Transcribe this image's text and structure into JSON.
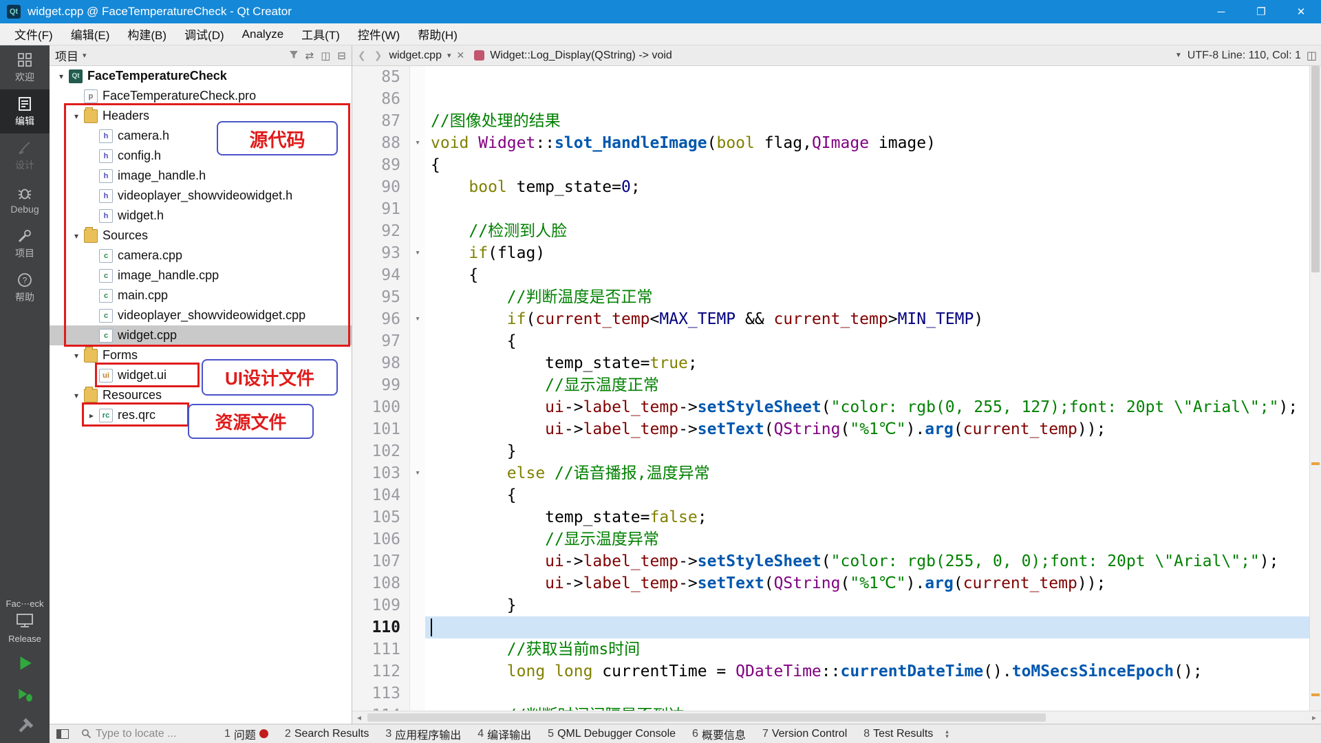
{
  "window": {
    "title": "widget.cpp @ FaceTemperatureCheck - Qt Creator",
    "controls": [
      {
        "id": "minimize",
        "glyph": "─"
      },
      {
        "id": "maximize",
        "glyph": "❐"
      },
      {
        "id": "close",
        "glyph": "✕"
      }
    ],
    "app_icon_text": "Qt"
  },
  "menu": {
    "items": [
      {
        "id": "file",
        "label": "文件(F)"
      },
      {
        "id": "edit",
        "label": "编辑(E)"
      },
      {
        "id": "build",
        "label": "构建(B)"
      },
      {
        "id": "debug",
        "label": "调试(D)"
      },
      {
        "id": "analyze",
        "label": "Analyze"
      },
      {
        "id": "tools",
        "label": "工具(T)"
      },
      {
        "id": "window",
        "label": "控件(W)"
      },
      {
        "id": "help",
        "label": "帮助(H)"
      }
    ]
  },
  "sidebar": {
    "modes": [
      {
        "id": "welcome",
        "label": "欢迎",
        "icon": "welcome-icon"
      },
      {
        "id": "edit",
        "label": "编辑",
        "icon": "edit-icon",
        "active": true
      },
      {
        "id": "design",
        "label": "设计",
        "icon": "design-icon",
        "disabled": true
      },
      {
        "id": "debug",
        "label": "Debug",
        "icon": "debug-icon"
      },
      {
        "id": "projects",
        "label": "项目",
        "icon": "projects-icon"
      },
      {
        "id": "help",
        "label": "帮助",
        "icon": "help-icon"
      }
    ],
    "kit": {
      "name": "Fac⋯eck",
      "build": "Release"
    }
  },
  "project": {
    "title": "项目",
    "header_icons": [
      {
        "id": "filter-icon",
        "glyph": "▼"
      },
      {
        "id": "sync-with-editor-icon",
        "glyph": "⇄"
      },
      {
        "id": "split-icon",
        "glyph": "◫"
      },
      {
        "id": "collapse-icon",
        "glyph": "⊟"
      }
    ],
    "tree": [
      {
        "label": "FaceTemperatureCheck",
        "depth": 0,
        "icon": "project",
        "chev": "d",
        "bold": true
      },
      {
        "label": "FaceTemperatureCheck.pro",
        "depth": 1,
        "icon": "pro"
      },
      {
        "label": "Headers",
        "depth": 1,
        "icon": "folder",
        "chev": "d"
      },
      {
        "label": "camera.h",
        "depth": 2,
        "icon": "h"
      },
      {
        "label": "config.h",
        "depth": 2,
        "icon": "h"
      },
      {
        "label": "image_handle.h",
        "depth": 2,
        "icon": "h"
      },
      {
        "label": "videoplayer_showvideowidget.h",
        "depth": 2,
        "icon": "h"
      },
      {
        "label": "widget.h",
        "depth": 2,
        "icon": "h"
      },
      {
        "label": "Sources",
        "depth": 1,
        "icon": "folder",
        "chev": "d"
      },
      {
        "label": "camera.cpp",
        "depth": 2,
        "icon": "cpp"
      },
      {
        "label": "image_handle.cpp",
        "depth": 2,
        "icon": "cpp"
      },
      {
        "label": "main.cpp",
        "depth": 2,
        "icon": "cpp"
      },
      {
        "label": "videoplayer_showvideowidget.cpp",
        "depth": 2,
        "icon": "cpp"
      },
      {
        "label": "widget.cpp",
        "depth": 2,
        "icon": "cpp",
        "selected": true
      },
      {
        "label": "Forms",
        "depth": 1,
        "icon": "folder",
        "chev": "d"
      },
      {
        "label": "widget.ui",
        "depth": 2,
        "icon": "ui"
      },
      {
        "label": "Resources",
        "depth": 1,
        "icon": "folder",
        "chev": "d"
      },
      {
        "label": "res.qrc",
        "depth": 2,
        "icon": "qrc",
        "chev": "r"
      }
    ]
  },
  "annotations": {
    "source_label": "源代码",
    "ui_label": "UI设计文件",
    "res_label": "资源文件"
  },
  "editor": {
    "toolbar": {
      "back": "❮",
      "forward": "❯",
      "tab": "widget.cpp",
      "tab_caret": "▾",
      "close": "✕",
      "symbol": "Widget::Log_Display(QString) -> void",
      "enc_caret": "▼",
      "encoding": "UTF-8 Line: 110, Col: 1",
      "split": "◫"
    },
    "lines": [
      {
        "n": 85,
        "tk": []
      },
      {
        "n": 86,
        "tk": []
      },
      {
        "n": 87,
        "tk": [
          [
            "c",
            "//图像处理的结果"
          ]
        ]
      },
      {
        "n": 88,
        "f": 1,
        "tk": [
          [
            "k",
            "void"
          ],
          [
            "d",
            " "
          ],
          [
            "t",
            "Widget"
          ],
          [
            "d",
            "::"
          ],
          [
            "fn",
            "slot_HandleImage"
          ],
          [
            "d",
            "("
          ],
          [
            "k",
            "bool"
          ],
          [
            "d",
            " flag,"
          ],
          [
            "t",
            "QImage"
          ],
          [
            "d",
            " image)"
          ]
        ]
      },
      {
        "n": 89,
        "tk": [
          [
            "d",
            "{"
          ]
        ]
      },
      {
        "n": 90,
        "tk": [
          [
            "d",
            "    "
          ],
          [
            "k",
            "bool"
          ],
          [
            "d",
            " temp_state="
          ],
          [
            "num",
            "0"
          ],
          [
            "d",
            ";"
          ]
        ]
      },
      {
        "n": 91,
        "tk": []
      },
      {
        "n": 92,
        "tk": [
          [
            "d",
            "    "
          ],
          [
            "c",
            "//检测到人脸"
          ]
        ]
      },
      {
        "n": 93,
        "f": 1,
        "tk": [
          [
            "d",
            "    "
          ],
          [
            "k",
            "if"
          ],
          [
            "d",
            "(flag)"
          ]
        ]
      },
      {
        "n": 94,
        "tk": [
          [
            "d",
            "    {"
          ]
        ]
      },
      {
        "n": 95,
        "tk": [
          [
            "d",
            "        "
          ],
          [
            "c",
            "//判断温度是否正常"
          ]
        ]
      },
      {
        "n": 96,
        "f": 1,
        "tk": [
          [
            "d",
            "        "
          ],
          [
            "k",
            "if"
          ],
          [
            "d",
            "("
          ],
          [
            "v",
            "current_temp"
          ],
          [
            "d",
            "<"
          ],
          [
            "m",
            "MAX_TEMP"
          ],
          [
            "d",
            " && "
          ],
          [
            "v",
            "current_temp"
          ],
          [
            "d",
            ">"
          ],
          [
            "m",
            "MIN_TEMP"
          ],
          [
            "d",
            ")"
          ]
        ]
      },
      {
        "n": 97,
        "tk": [
          [
            "d",
            "        {"
          ]
        ]
      },
      {
        "n": 98,
        "tk": [
          [
            "d",
            "            temp_state="
          ],
          [
            "k",
            "true"
          ],
          [
            "d",
            ";"
          ]
        ]
      },
      {
        "n": 99,
        "tk": [
          [
            "d",
            "            "
          ],
          [
            "c",
            "//显示温度正常"
          ]
        ]
      },
      {
        "n": 100,
        "tk": [
          [
            "d",
            "            "
          ],
          [
            "v",
            "ui"
          ],
          [
            "d",
            "->"
          ],
          [
            "v",
            "label_temp"
          ],
          [
            "d",
            "->"
          ],
          [
            "fn",
            "setStyleSheet"
          ],
          [
            "d",
            "("
          ],
          [
            "s",
            "\"color: rgb(0, 255, 127);font: 20pt \\\"Arial\\\";\""
          ],
          [
            "d",
            ");"
          ]
        ]
      },
      {
        "n": 101,
        "tk": [
          [
            "d",
            "            "
          ],
          [
            "v",
            "ui"
          ],
          [
            "d",
            "->"
          ],
          [
            "v",
            "label_temp"
          ],
          [
            "d",
            "->"
          ],
          [
            "fn",
            "setText"
          ],
          [
            "d",
            "("
          ],
          [
            "t",
            "QString"
          ],
          [
            "d",
            "("
          ],
          [
            "s",
            "\"%1℃\""
          ],
          [
            "d",
            ")."
          ],
          [
            "fn",
            "arg"
          ],
          [
            "d",
            "("
          ],
          [
            "v",
            "current_temp"
          ],
          [
            "d",
            "));"
          ]
        ]
      },
      {
        "n": 102,
        "tk": [
          [
            "d",
            "        }"
          ]
        ]
      },
      {
        "n": 103,
        "f": 1,
        "tk": [
          [
            "d",
            "        "
          ],
          [
            "k",
            "else"
          ],
          [
            "d",
            " "
          ],
          [
            "c",
            "//语音播报,温度异常"
          ]
        ]
      },
      {
        "n": 104,
        "tk": [
          [
            "d",
            "        {"
          ]
        ]
      },
      {
        "n": 105,
        "tk": [
          [
            "d",
            "            temp_state="
          ],
          [
            "k",
            "false"
          ],
          [
            "d",
            ";"
          ]
        ]
      },
      {
        "n": 106,
        "tk": [
          [
            "d",
            "            "
          ],
          [
            "c",
            "//显示温度异常"
          ]
        ]
      },
      {
        "n": 107,
        "tk": [
          [
            "d",
            "            "
          ],
          [
            "v",
            "ui"
          ],
          [
            "d",
            "->"
          ],
          [
            "v",
            "label_temp"
          ],
          [
            "d",
            "->"
          ],
          [
            "fn",
            "setStyleSheet"
          ],
          [
            "d",
            "("
          ],
          [
            "s",
            "\"color: rgb(255, 0, 0);font: 20pt \\\"Arial\\\";\""
          ],
          [
            "d",
            ");"
          ]
        ]
      },
      {
        "n": 108,
        "tk": [
          [
            "d",
            "            "
          ],
          [
            "v",
            "ui"
          ],
          [
            "d",
            "->"
          ],
          [
            "v",
            "label_temp"
          ],
          [
            "d",
            "->"
          ],
          [
            "fn",
            "setText"
          ],
          [
            "d",
            "("
          ],
          [
            "t",
            "QString"
          ],
          [
            "d",
            "("
          ],
          [
            "s",
            "\"%1℃\""
          ],
          [
            "d",
            ")."
          ],
          [
            "fn",
            "arg"
          ],
          [
            "d",
            "("
          ],
          [
            "v",
            "current_temp"
          ],
          [
            "d",
            "));"
          ]
        ]
      },
      {
        "n": 109,
        "tk": [
          [
            "d",
            "        }"
          ]
        ]
      },
      {
        "n": 110,
        "cur": 1,
        "tk": []
      },
      {
        "n": 111,
        "tk": [
          [
            "d",
            "        "
          ],
          [
            "c",
            "//获取当前ms时间"
          ]
        ]
      },
      {
        "n": 112,
        "tk": [
          [
            "d",
            "        "
          ],
          [
            "k",
            "long"
          ],
          [
            "d",
            " "
          ],
          [
            "k",
            "long"
          ],
          [
            "d",
            " currentTime = "
          ],
          [
            "t",
            "QDateTime"
          ],
          [
            "d",
            "::"
          ],
          [
            "fn",
            "currentDateTime"
          ],
          [
            "d",
            "()."
          ],
          [
            "fn",
            "toMSecsSinceEpoch"
          ],
          [
            "d",
            "();"
          ]
        ]
      },
      {
        "n": 113,
        "tk": []
      },
      {
        "n": 114,
        "tk": [
          [
            "d",
            "        "
          ],
          [
            "c",
            "//判断时间间隔是否到达"
          ]
        ]
      }
    ]
  },
  "bottom": {
    "locate": "Type to locate ...",
    "panels": [
      {
        "id": "issues",
        "num": "1",
        "label": "问题",
        "badge": true
      },
      {
        "id": "search-results",
        "num": "2",
        "label": "Search Results"
      },
      {
        "id": "application-output",
        "num": "3",
        "label": "应用程序输出"
      },
      {
        "id": "compile-output",
        "num": "4",
        "label": "编译输出"
      },
      {
        "id": "qml-debugger-console",
        "num": "5",
        "label": "QML Debugger Console"
      },
      {
        "id": "general-messages",
        "num": "6",
        "label": "概要信息"
      },
      {
        "id": "version-control",
        "num": "7",
        "label": "Version Control"
      },
      {
        "id": "test-results",
        "num": "8",
        "label": "Test Results"
      }
    ]
  }
}
